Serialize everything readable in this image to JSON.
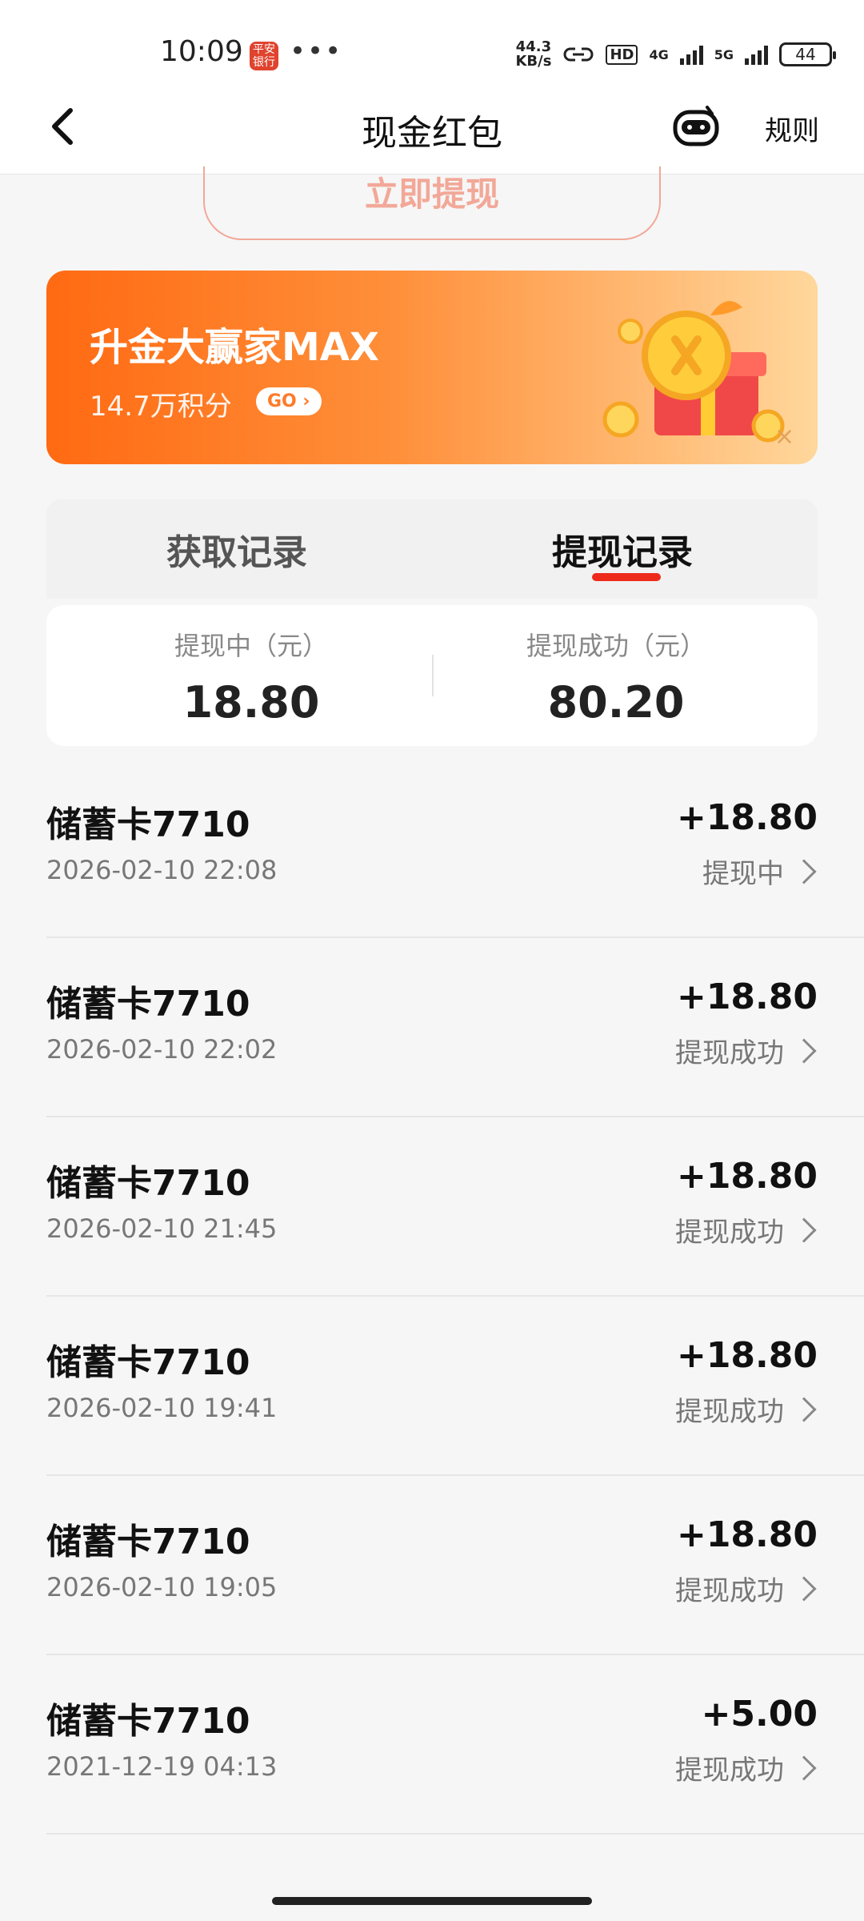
{
  "status_bar": {
    "time": "10:09",
    "app_icon_text": "平安\n银行",
    "dots": "•••",
    "net_speed": "44.3",
    "net_unit": "KB/s",
    "hd_badge": "HD",
    "signal_1": "4G",
    "signal_2": "5G",
    "battery": "44"
  },
  "header": {
    "title": "现金红包",
    "rules_label": "规则"
  },
  "withdraw_button": {
    "label": "立即提现"
  },
  "banner": {
    "title": "升金大赢家MAX",
    "subtitle": "14.7万积分",
    "go_label": "GO ›",
    "close": "×",
    "colors": {
      "start": "#ff6a12",
      "end": "#ffd79c"
    }
  },
  "tabs": [
    {
      "label": "获取记录",
      "active": false
    },
    {
      "label": "提现记录",
      "active": true
    }
  ],
  "summary": {
    "pending_label": "提现中（元）",
    "pending_value": "18.80",
    "success_label": "提现成功（元）",
    "success_value": "80.20"
  },
  "records": [
    {
      "name": "储蓄卡7710",
      "date": "2026-02-10 22:08",
      "amount": "+18.80",
      "status": "提现中"
    },
    {
      "name": "储蓄卡7710",
      "date": "2026-02-10 22:02",
      "amount": "+18.80",
      "status": "提现成功"
    },
    {
      "name": "储蓄卡7710",
      "date": "2026-02-10 21:45",
      "amount": "+18.80",
      "status": "提现成功"
    },
    {
      "name": "储蓄卡7710",
      "date": "2026-02-10 19:41",
      "amount": "+18.80",
      "status": "提现成功"
    },
    {
      "name": "储蓄卡7710",
      "date": "2026-02-10 19:05",
      "amount": "+18.80",
      "status": "提现成功"
    },
    {
      "name": "储蓄卡7710",
      "date": "2021-12-19 04:13",
      "amount": "+5.00",
      "status": "提现成功"
    }
  ],
  "accent_color": "#ee2a1c"
}
